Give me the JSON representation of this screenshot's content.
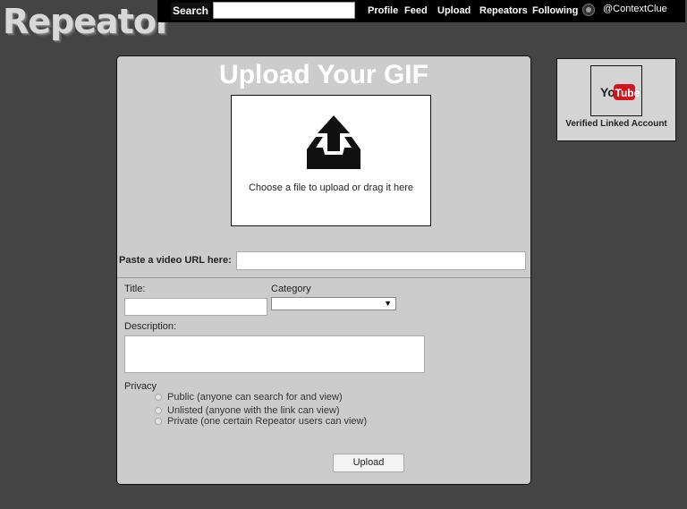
{
  "app": {
    "logo": "Repeator"
  },
  "header": {
    "search_label": "Search",
    "search_value": "",
    "nav": [
      "Profile",
      "Feed",
      "Upload",
      "Repeators",
      "Following"
    ],
    "username": "@ContextClue"
  },
  "upload": {
    "title": "Upload Your GIF",
    "drop_text": "Choose a file to upload or drag it here",
    "url_label": "Paste a video URL here:",
    "title_label": "Title:",
    "category_label": "Category",
    "category_value": "",
    "description_label": "Description:",
    "privacy_label": "Privacy",
    "privacy_options": [
      "Public (anyone can search for and view)",
      "Unlisted (anyone with the link can view)",
      "Private (one certain Repeator users can view)"
    ],
    "button_label": "Upload"
  },
  "side": {
    "youtube_logo_text_1": "You",
    "youtube_logo_text_2": "Tube",
    "verified_label": "Verified Linked Account"
  }
}
